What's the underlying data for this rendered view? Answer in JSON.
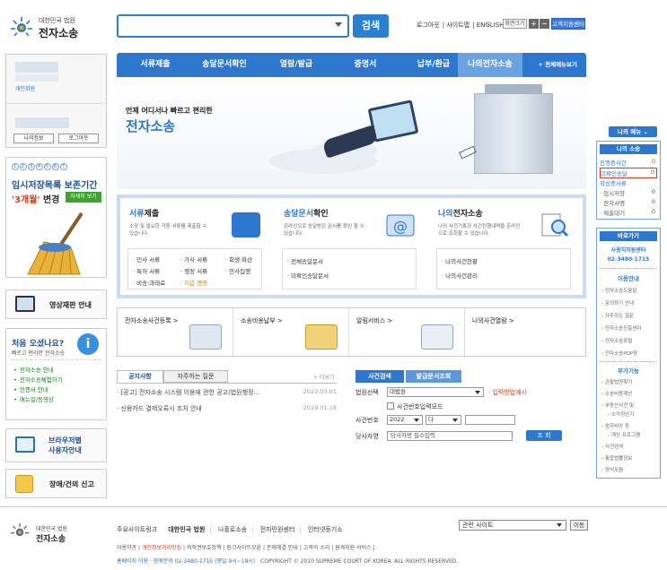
{
  "header": {
    "logo_small": "대한민국 법원",
    "logo_big": "전자소송",
    "search_button": "검색",
    "top_links": [
      "로그아웃",
      "사이트맵",
      "ENGLISH"
    ],
    "zoom_label": "화면크기",
    "zoom_in": "+",
    "zoom_out": "−",
    "center_link": "고객지원센터"
  },
  "nav": {
    "items": [
      "서류제출",
      "송달문서확인",
      "열람/발급",
      "증명서",
      "납부/환급",
      "나의전자소송"
    ],
    "active_index": 5,
    "all_menu": "+ 전체메뉴보기"
  },
  "login": {
    "label": "개인회원",
    "my_info": "나의정보",
    "logout": "로그아웃"
  },
  "promo": {
    "controls": [
      "1",
      "2",
      "3",
      "4",
      "5",
      "6",
      "7"
    ],
    "title": "임시저장목록 보존기간",
    "period": "'3개월'",
    "change": " 변경",
    "more": "자세히 보기"
  },
  "video": {
    "label": "영상재판 안내"
  },
  "first_visit": {
    "title": "처음 오셨나요?",
    "subtitle": "빠르고 편리한 전자소송",
    "info_icon": "i",
    "links": [
      "전자소송 안내",
      "전자소송체험하기",
      "인증서 안내",
      "매뉴얼/동영상"
    ]
  },
  "browser": {
    "line1": "브라우저별",
    "line2": "사용자안내"
  },
  "report": {
    "label": "장애/건의 신고"
  },
  "hero": {
    "subtitle": "언제 어디서나 빠르고 편리한",
    "title": "전자소송"
  },
  "services": [
    {
      "title_a": "서류",
      "title_b": "제출",
      "desc": "소장 및 필요한 각종 서류를 제출할 수 있습니다.",
      "items": [
        "민사 서류",
        "가사 서류",
        "회생·파산",
        "특허 서류",
        "행정 서류",
        "민사집행",
        "비송·과태료",
        "지급 명령"
      ]
    },
    {
      "title_a": "송달문서",
      "title_b": "확인",
      "desc": "온라인으로 송달받은 문서를 확인 할 수 있습니다.",
      "items": [
        "전체송달문서",
        "미확인송달문서"
      ]
    },
    {
      "title_a": "나의",
      "title_b": "전자소송",
      "desc": "나의 사건기록과 사건진행내역을 온라인으로 조회할 수 있습니다.",
      "items": [
        "나의사건현황",
        "나의사건관리"
      ]
    }
  ],
  "quick_links": [
    "전자소송사건등록 >",
    "소송비용납부 >",
    "알림서비스 >",
    "나의사건열람 >"
  ],
  "notices": {
    "tabs": [
      "공지사항",
      "자주하는 질문"
    ],
    "more": "+ 더보기",
    "items": [
      {
        "title": "· [공고] 전자소송 시스템 이용에 관한 공고(법원행정...",
        "date": "2022.03.01"
      },
      {
        "title": "· 신용카드 결제오류시 조치 안내",
        "date": "2019.01.18"
      }
    ]
  },
  "case_search": {
    "tabs": [
      "사건검색",
      "발급문서조회"
    ],
    "court_label": "법원선택",
    "court_value": "대법원",
    "input_method": "· 입력방법예시",
    "case_mode": "사건번호입력모드",
    "case_no_label": "사건번호",
    "year_value": "2022",
    "type_value": "다",
    "party_label": "당사자명",
    "party_placeholder": "당사자명 필수입력",
    "search_button": "조 회"
  },
  "my_menu": {
    "button": "나의 메뉴 ⌄",
    "heading": "나의 소송",
    "rows": [
      {
        "label": "진행중사건",
        "value": "0",
        "style": "blue"
      },
      {
        "label": "미확인송달",
        "value": "0",
        "style": "highlight"
      },
      {
        "label": "작성중서류",
        "value": "",
        "style": "blue"
      },
      {
        "label": "· 임시저장",
        "value": "0",
        "style": "gray"
      },
      {
        "label": "· 전자서명",
        "value": "0",
        "style": "gray"
      },
      {
        "label": "· 제출대기",
        "value": "0",
        "style": "gray"
      }
    ]
  },
  "shortcuts": {
    "heading": "바로가기",
    "center_line1": "사용지지원센터",
    "center_line2": "02-3480-1715",
    "guide_heading": "이용안내",
    "guide_items": [
      "전자소송도움말",
      "문의하기 안내",
      "자주하는 질문",
      "전자소송진흥센터",
      "전자소송포털",
      "전자소송POP창"
    ],
    "func_heading": "부가기능",
    "func_items": [
      "관할법원찾기",
      "소송비용계산",
      "부동산사건 및",
      "소각정산기",
      "송하비상 등",
      "계산 프로그램",
      "사건검색",
      "통합법률정보",
      "양식모음"
    ]
  },
  "footer": {
    "logo_small": "대한민국 법원",
    "logo_big": "전자소송",
    "links_label": "주요사이트링크",
    "links": [
      "대한민국 법원",
      "나홀로소송",
      "전자민원센터",
      "인터넷등기소"
    ],
    "related_select": "관련 사이트",
    "go_button": "이동",
    "policy_start": "이용약관",
    "policy_red": "개인정보처리방침",
    "policy_rest": "| 저작권보호정책 | 링크사이트모음 | 문제해결 안내 | 고객의 소리 | 원격지원 서비스 |",
    "phone": "홈페이지 이용 · 장애문의 02-3480-1715 (평일 9시~18시)",
    "copyright": "COPYRIGHT © 2010 SUPREME COURT OF KOREA. ALL RIGHTS RESERVED."
  }
}
